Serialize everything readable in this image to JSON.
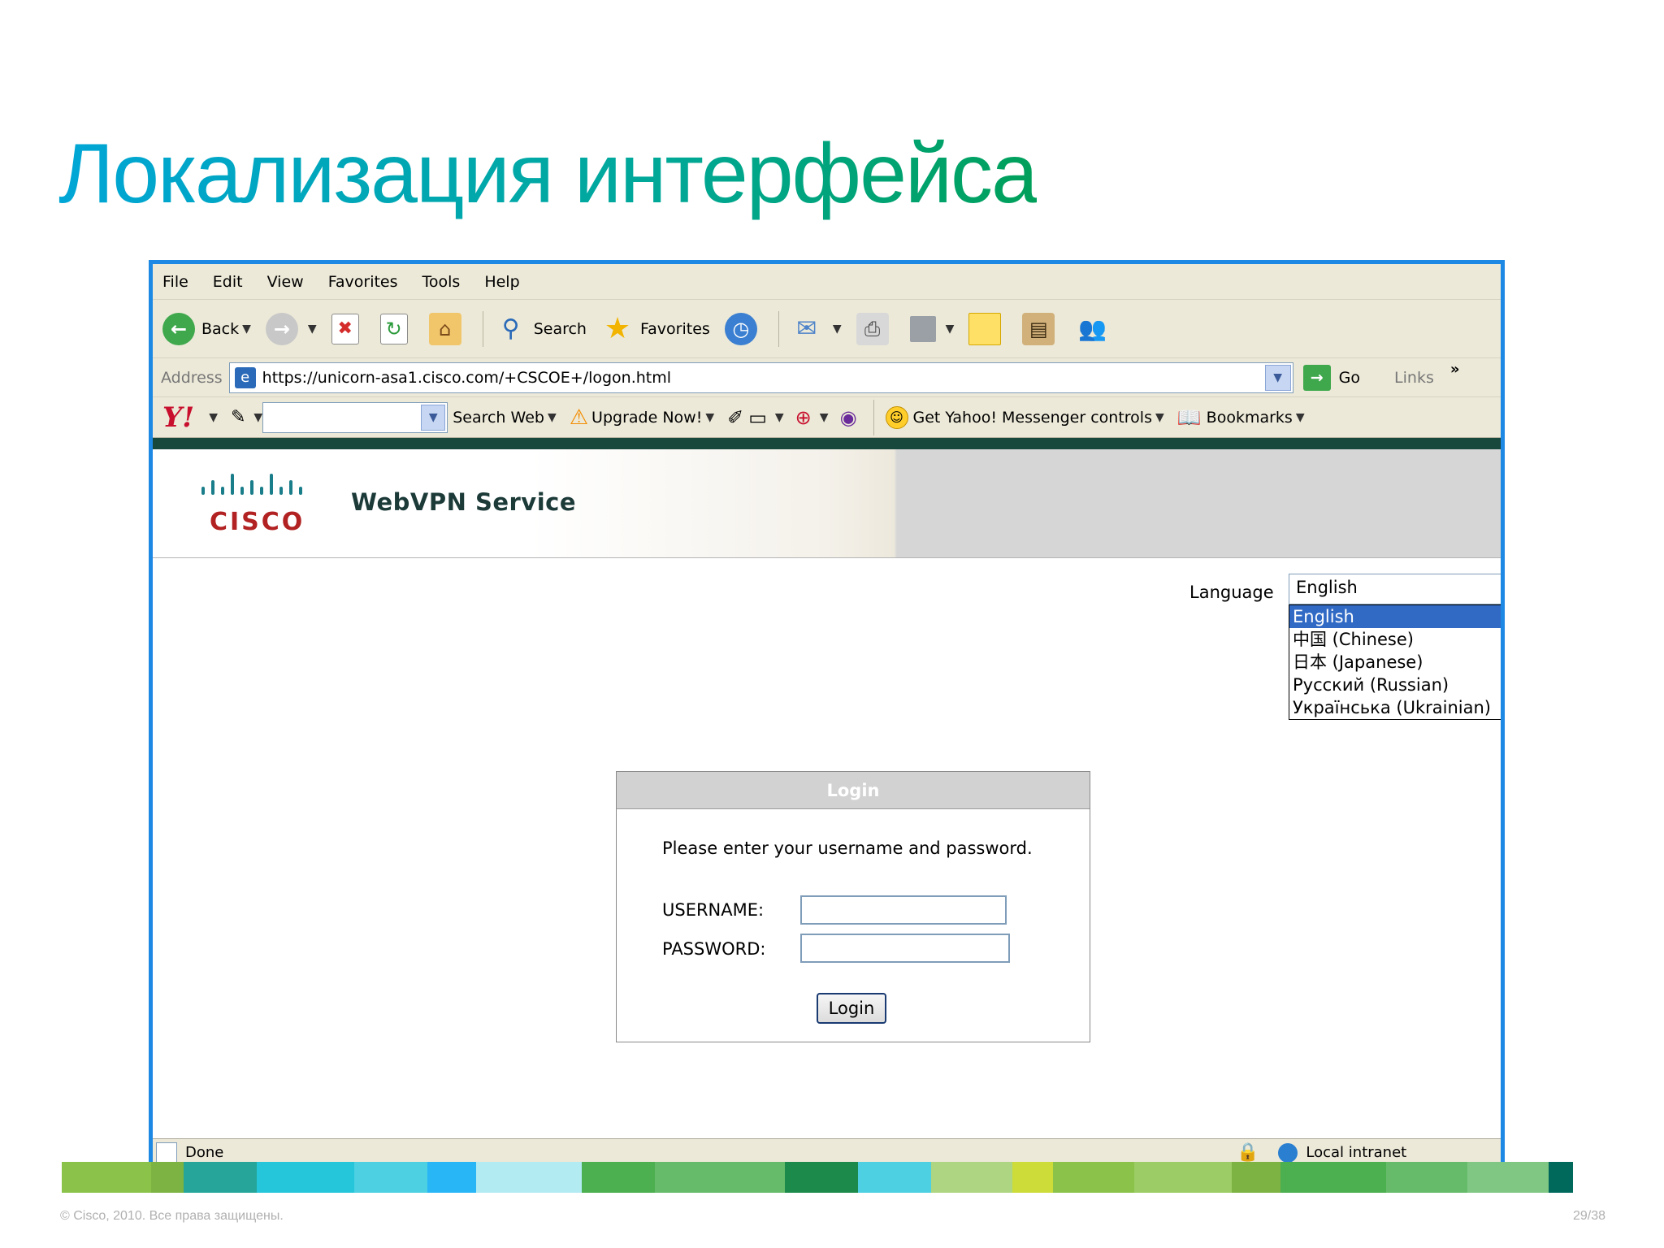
{
  "slide": {
    "title": "Локализация интерфейса",
    "footer_left": "© Cisco, 2010. Все права защищены.",
    "footer_right": "29/38"
  },
  "browser": {
    "menu": [
      "File",
      "Edit",
      "View",
      "Favorites",
      "Tools",
      "Help"
    ],
    "toolbar": {
      "back": "Back",
      "search": "Search",
      "favorites": "Favorites"
    },
    "address": {
      "label": "Address",
      "url": "https://unicorn-asa1.cisco.com/+CSCOE+/logon.html",
      "go": "Go",
      "links": "Links",
      "chevron": "»"
    },
    "yahoo": {
      "logo": "Y!",
      "search_web": "Search Web",
      "upgrade": "Upgrade Now!",
      "messenger": "Get Yahoo! Messenger controls",
      "bookmarks": "Bookmarks"
    },
    "status": {
      "left": "Done",
      "right": "Local intranet"
    }
  },
  "page": {
    "banner": {
      "logo_text": "CISCO",
      "service_title": "WebVPN Service"
    },
    "language": {
      "label": "Language",
      "selected": "English",
      "options": [
        "English",
        "中国 (Chinese)",
        "日本 (Japanese)",
        "Русский (Russian)",
        "Українська (Ukrainian)"
      ]
    },
    "login": {
      "header": "Login",
      "message": "Please enter your username and password.",
      "username_label": "USERNAME:",
      "password_label": "PASSWORD:",
      "button": "Login"
    }
  },
  "colors": {
    "accent_frame": "#1e88e5",
    "title_gradient_start": "#00a6d6",
    "title_gradient_end": "#00a05a",
    "selected_option": "#316ac5",
    "cisco_red": "#b22222"
  }
}
